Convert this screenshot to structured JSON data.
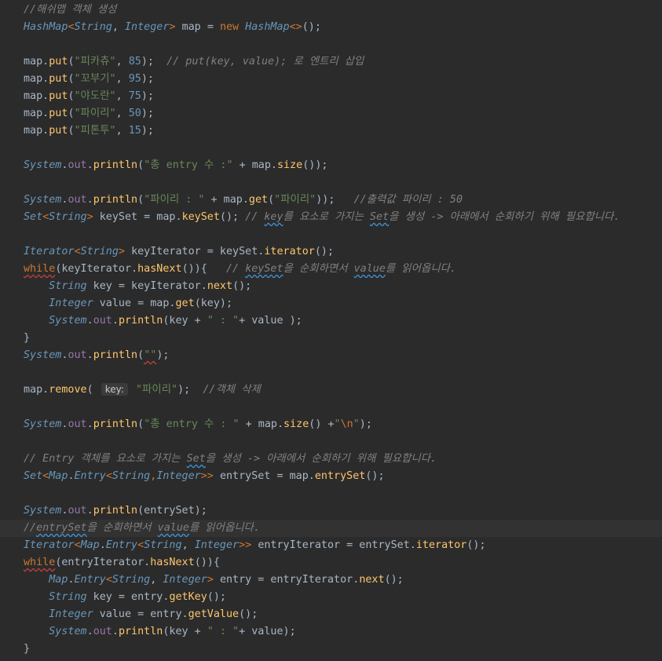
{
  "editor": {
    "current_line_index": 30,
    "lines": [
      [
        {
          "t": "//해쉬맵 객체 생성",
          "c": "cm"
        }
      ],
      [
        {
          "t": "HashMap",
          "c": "cls"
        },
        {
          "t": "<",
          "c": "kw"
        },
        {
          "t": "String",
          "c": "cls"
        },
        {
          "t": ", "
        },
        {
          "t": "Integer",
          "c": "cls"
        },
        {
          "t": "> ",
          "c": "kw"
        },
        {
          "t": "map "
        },
        {
          "t": "= "
        },
        {
          "t": "new ",
          "c": "kw"
        },
        {
          "t": "HashMap",
          "c": "cls"
        },
        {
          "t": "<>",
          "c": "kw"
        },
        {
          "t": "();"
        }
      ],
      [],
      [
        {
          "t": "map."
        },
        {
          "t": "put",
          "c": "fn"
        },
        {
          "t": "("
        },
        {
          "t": "\"피카츄\"",
          "c": "str"
        },
        {
          "t": ", "
        },
        {
          "t": "85",
          "c": "num"
        },
        {
          "t": ");  "
        },
        {
          "t": "// put(key, value); 로 엔트리 삽입",
          "c": "cm"
        }
      ],
      [
        {
          "t": "map."
        },
        {
          "t": "put",
          "c": "fn"
        },
        {
          "t": "("
        },
        {
          "t": "\"꼬부기\"",
          "c": "str"
        },
        {
          "t": ", "
        },
        {
          "t": "95",
          "c": "num"
        },
        {
          "t": ");"
        }
      ],
      [
        {
          "t": "map."
        },
        {
          "t": "put",
          "c": "fn"
        },
        {
          "t": "("
        },
        {
          "t": "\"야도란\"",
          "c": "str"
        },
        {
          "t": ", "
        },
        {
          "t": "75",
          "c": "num"
        },
        {
          "t": ");"
        }
      ],
      [
        {
          "t": "map."
        },
        {
          "t": "put",
          "c": "fn"
        },
        {
          "t": "("
        },
        {
          "t": "\"파이리\"",
          "c": "str"
        },
        {
          "t": ", "
        },
        {
          "t": "50",
          "c": "num"
        },
        {
          "t": ");"
        }
      ],
      [
        {
          "t": "map."
        },
        {
          "t": "put",
          "c": "fn"
        },
        {
          "t": "("
        },
        {
          "t": "\"피톤투\"",
          "c": "str"
        },
        {
          "t": ", "
        },
        {
          "t": "15",
          "c": "num"
        },
        {
          "t": ");"
        }
      ],
      [],
      [
        {
          "t": "System",
          "c": "cls"
        },
        {
          "t": "."
        },
        {
          "t": "out",
          "c": "fld"
        },
        {
          "t": "."
        },
        {
          "t": "println",
          "c": "fn"
        },
        {
          "t": "("
        },
        {
          "t": "\"총 entry 수 :\"",
          "c": "str"
        },
        {
          "t": " + map."
        },
        {
          "t": "size",
          "c": "fn"
        },
        {
          "t": "());"
        }
      ],
      [],
      [
        {
          "t": "System",
          "c": "cls"
        },
        {
          "t": "."
        },
        {
          "t": "out",
          "c": "fld"
        },
        {
          "t": "."
        },
        {
          "t": "println",
          "c": "fn"
        },
        {
          "t": "("
        },
        {
          "t": "\"파이리 : \"",
          "c": "str"
        },
        {
          "t": " + map."
        },
        {
          "t": "get",
          "c": "fn"
        },
        {
          "t": "("
        },
        {
          "t": "\"파이리\"",
          "c": "str"
        },
        {
          "t": "));   "
        },
        {
          "t": "//출력값 파이리 : 50",
          "c": "cm"
        }
      ],
      [
        {
          "t": "Set",
          "c": "cls"
        },
        {
          "t": "<",
          "c": "kw"
        },
        {
          "t": "String",
          "c": "cls"
        },
        {
          "t": "> ",
          "c": "kw"
        },
        {
          "t": "keySet = map."
        },
        {
          "t": "keySet",
          "c": "fn"
        },
        {
          "t": "(); "
        },
        {
          "t": "// ",
          "c": "cm"
        },
        {
          "t": "key",
          "c": "cm",
          "u": "squig"
        },
        {
          "t": "를 요소로 가지는 ",
          "c": "cm"
        },
        {
          "t": "Set",
          "c": "cm",
          "u": "squig"
        },
        {
          "t": "을 생성 -> 아래에서 순회하기 위해 필요합니다.",
          "c": "cm"
        }
      ],
      [],
      [
        {
          "t": "Iterator",
          "c": "cls"
        },
        {
          "t": "<",
          "c": "kw"
        },
        {
          "t": "String",
          "c": "cls"
        },
        {
          "t": "> ",
          "c": "kw"
        },
        {
          "t": "keyIterator = keySet."
        },
        {
          "t": "iterator",
          "c": "fn"
        },
        {
          "t": "();"
        }
      ],
      [
        {
          "t": "while",
          "c": "kw",
          "u": "err"
        },
        {
          "t": "(keyIterator."
        },
        {
          "t": "hasNext",
          "c": "fn"
        },
        {
          "t": "()){   "
        },
        {
          "t": "// ",
          "c": "cm"
        },
        {
          "t": "keySet",
          "c": "cm",
          "u": "squig"
        },
        {
          "t": "을 순회하면서 ",
          "c": "cm"
        },
        {
          "t": "value",
          "c": "cm",
          "u": "squig"
        },
        {
          "t": "를 읽어옵니다.",
          "c": "cm"
        }
      ],
      [
        {
          "t": "    "
        },
        {
          "t": "String",
          "c": "cls"
        },
        {
          "t": " key = keyIterator."
        },
        {
          "t": "next",
          "c": "fn"
        },
        {
          "t": "();"
        }
      ],
      [
        {
          "t": "    "
        },
        {
          "t": "Integer",
          "c": "cls"
        },
        {
          "t": " value = map."
        },
        {
          "t": "get",
          "c": "fn"
        },
        {
          "t": "(key);"
        }
      ],
      [
        {
          "t": "    "
        },
        {
          "t": "System",
          "c": "cls"
        },
        {
          "t": "."
        },
        {
          "t": "out",
          "c": "fld"
        },
        {
          "t": "."
        },
        {
          "t": "println",
          "c": "fn"
        },
        {
          "t": "(key + "
        },
        {
          "t": "\" : \"",
          "c": "str"
        },
        {
          "t": "+ value );"
        }
      ],
      [
        {
          "t": "}"
        }
      ],
      [
        {
          "t": "System",
          "c": "cls"
        },
        {
          "t": "."
        },
        {
          "t": "out",
          "c": "fld"
        },
        {
          "t": "."
        },
        {
          "t": "println",
          "c": "fn"
        },
        {
          "t": "("
        },
        {
          "t": "\"\"",
          "c": "str",
          "u": "err"
        },
        {
          "t": ");"
        }
      ],
      [],
      [
        {
          "t": "map."
        },
        {
          "t": "remove",
          "c": "fn"
        },
        {
          "t": "( "
        },
        {
          "hint": "key:"
        },
        {
          "t": " "
        },
        {
          "t": "\"파이리\"",
          "c": "str"
        },
        {
          "t": ");  "
        },
        {
          "t": "//객체 삭제",
          "c": "cm"
        }
      ],
      [],
      [
        {
          "t": "System",
          "c": "cls"
        },
        {
          "t": "."
        },
        {
          "t": "out",
          "c": "fld"
        },
        {
          "t": "."
        },
        {
          "t": "println",
          "c": "fn"
        },
        {
          "t": "("
        },
        {
          "t": "\"총 entry 수 : \"",
          "c": "str"
        },
        {
          "t": " + map."
        },
        {
          "t": "size",
          "c": "fn"
        },
        {
          "t": "() +"
        },
        {
          "t": "\"",
          "c": "str"
        },
        {
          "t": "\\n",
          "c": "esc"
        },
        {
          "t": "\"",
          "c": "str"
        },
        {
          "t": ");"
        }
      ],
      [],
      [
        {
          "t": "// Entry 객체를 요소로 가지는 ",
          "c": "cm"
        },
        {
          "t": "Set",
          "c": "cm",
          "u": "squig"
        },
        {
          "t": "을 생성 -> 아래에서 순회하기 위해 필요합니다.",
          "c": "cm"
        }
      ],
      [
        {
          "t": "Set",
          "c": "cls"
        },
        {
          "t": "<",
          "c": "kw"
        },
        {
          "t": "Map",
          "c": "cls"
        },
        {
          "t": "."
        },
        {
          "t": "Entry",
          "c": "cls"
        },
        {
          "t": "<",
          "c": "kw"
        },
        {
          "t": "String",
          "c": "cls"
        },
        {
          "t": ",",
          "c": "kw"
        },
        {
          "t": "Integer",
          "c": "cls"
        },
        {
          "t": ">> ",
          "c": "kw"
        },
        {
          "t": "entrySet = map."
        },
        {
          "t": "entrySet",
          "c": "fn"
        },
        {
          "t": "();"
        }
      ],
      [],
      [
        {
          "t": "System",
          "c": "cls"
        },
        {
          "t": "."
        },
        {
          "t": "out",
          "c": "fld"
        },
        {
          "t": "."
        },
        {
          "t": "println",
          "c": "fn"
        },
        {
          "t": "(entrySet);"
        }
      ],
      [
        {
          "t": "//",
          "c": "cm"
        },
        {
          "t": "entrySet",
          "c": "cm",
          "u": "squig"
        },
        {
          "t": "을 순회하면서 ",
          "c": "cm"
        },
        {
          "t": "value",
          "c": "cm",
          "u": "squig"
        },
        {
          "t": "를 읽어옵니다.",
          "c": "cm"
        }
      ],
      [
        {
          "t": "Iterator",
          "c": "cls"
        },
        {
          "t": "<",
          "c": "kw"
        },
        {
          "t": "Map",
          "c": "cls"
        },
        {
          "t": "."
        },
        {
          "t": "Entry",
          "c": "cls"
        },
        {
          "t": "<",
          "c": "kw"
        },
        {
          "t": "String",
          "c": "cls"
        },
        {
          "t": ", "
        },
        {
          "t": "Integer",
          "c": "cls"
        },
        {
          "t": ">> ",
          "c": "kw"
        },
        {
          "t": "entryIterator = entrySet."
        },
        {
          "t": "iterator",
          "c": "fn"
        },
        {
          "t": "();"
        }
      ],
      [
        {
          "t": "while",
          "c": "kw",
          "u": "err"
        },
        {
          "t": "(entryIterator."
        },
        {
          "t": "hasNext",
          "c": "fn"
        },
        {
          "t": "()){"
        }
      ],
      [
        {
          "t": "    "
        },
        {
          "t": "Map",
          "c": "cls"
        },
        {
          "t": "."
        },
        {
          "t": "Entry",
          "c": "cls"
        },
        {
          "t": "<",
          "c": "kw"
        },
        {
          "t": "String",
          "c": "cls"
        },
        {
          "t": ", "
        },
        {
          "t": "Integer",
          "c": "cls"
        },
        {
          "t": "> ",
          "c": "kw"
        },
        {
          "t": "entry = entryIterator."
        },
        {
          "t": "next",
          "c": "fn"
        },
        {
          "t": "();"
        }
      ],
      [
        {
          "t": "    "
        },
        {
          "t": "String",
          "c": "cls"
        },
        {
          "t": " key = entry."
        },
        {
          "t": "getKey",
          "c": "fn"
        },
        {
          "t": "();"
        }
      ],
      [
        {
          "t": "    "
        },
        {
          "t": "Integer",
          "c": "cls"
        },
        {
          "t": " value = entry."
        },
        {
          "t": "getValue",
          "c": "fn"
        },
        {
          "t": "();"
        }
      ],
      [
        {
          "t": "    "
        },
        {
          "t": "System",
          "c": "cls"
        },
        {
          "t": "."
        },
        {
          "t": "out",
          "c": "fld"
        },
        {
          "t": "."
        },
        {
          "t": "println",
          "c": "fn"
        },
        {
          "t": "(key + "
        },
        {
          "t": "\" : \"",
          "c": "str"
        },
        {
          "t": "+ value);"
        }
      ],
      [
        {
          "t": "}"
        }
      ]
    ]
  }
}
